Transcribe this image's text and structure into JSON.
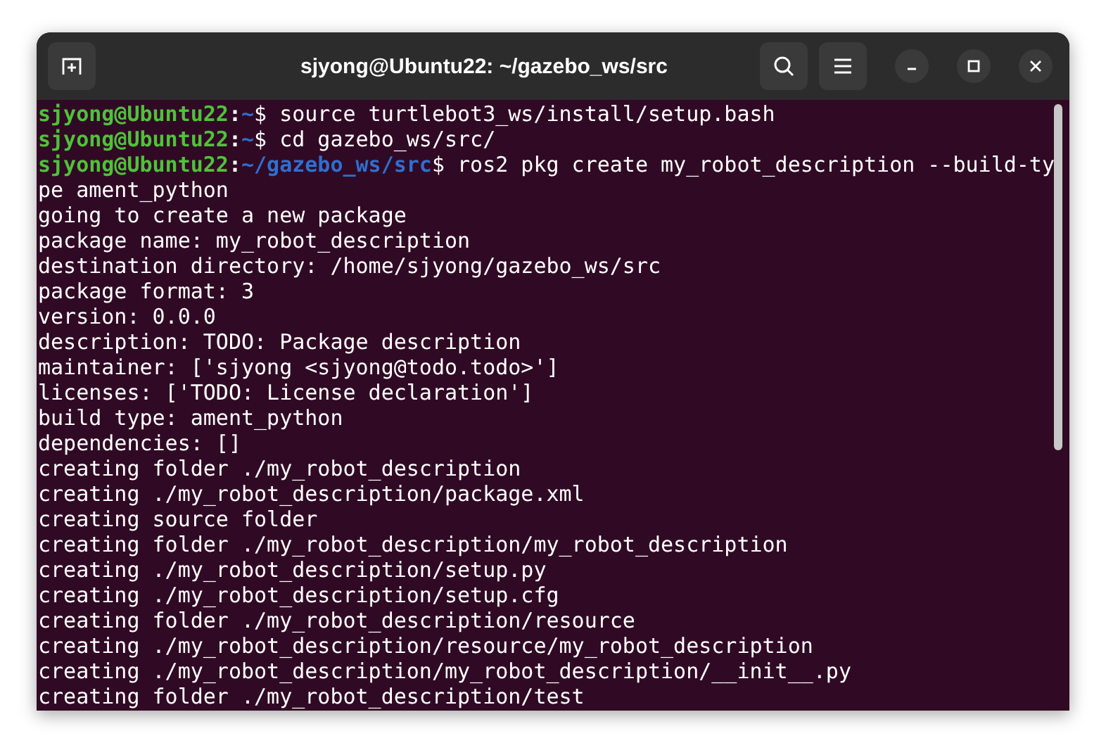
{
  "window": {
    "title": "sjyong@Ubuntu22: ~/gazebo_ws/src"
  },
  "terminal": {
    "lines": [
      {
        "kind": "prompt",
        "user": "sjyong@Ubuntu22",
        "sep": ":",
        "path": "~",
        "symbol": "$",
        "command": " source turtlebot3_ws/install/setup.bash"
      },
      {
        "kind": "prompt",
        "user": "sjyong@Ubuntu22",
        "sep": ":",
        "path": "~",
        "symbol": "$",
        "command": " cd gazebo_ws/src/"
      },
      {
        "kind": "prompt",
        "user": "sjyong@Ubuntu22",
        "sep": ":",
        "path": "~/gazebo_ws/src",
        "symbol": "$",
        "command": " ros2 pkg create my_robot_description --build-ty"
      },
      {
        "kind": "output",
        "text": "pe ament_python"
      },
      {
        "kind": "output",
        "text": "going to create a new package"
      },
      {
        "kind": "output",
        "text": "package name: my_robot_description"
      },
      {
        "kind": "output",
        "text": "destination directory: /home/sjyong/gazebo_ws/src"
      },
      {
        "kind": "output",
        "text": "package format: 3"
      },
      {
        "kind": "output",
        "text": "version: 0.0.0"
      },
      {
        "kind": "output",
        "text": "description: TODO: Package description"
      },
      {
        "kind": "output",
        "text": "maintainer: ['sjyong <sjyong@todo.todo>']"
      },
      {
        "kind": "output",
        "text": "licenses: ['TODO: License declaration']"
      },
      {
        "kind": "output",
        "text": "build type: ament_python"
      },
      {
        "kind": "output",
        "text": "dependencies: []"
      },
      {
        "kind": "output",
        "text": "creating folder ./my_robot_description"
      },
      {
        "kind": "output",
        "text": "creating ./my_robot_description/package.xml"
      },
      {
        "kind": "output",
        "text": "creating source folder"
      },
      {
        "kind": "output",
        "text": "creating folder ./my_robot_description/my_robot_description"
      },
      {
        "kind": "output",
        "text": "creating ./my_robot_description/setup.py"
      },
      {
        "kind": "output",
        "text": "creating ./my_robot_description/setup.cfg"
      },
      {
        "kind": "output",
        "text": "creating folder ./my_robot_description/resource"
      },
      {
        "kind": "output",
        "text": "creating ./my_robot_description/resource/my_robot_description"
      },
      {
        "kind": "output",
        "text": "creating ./my_robot_description/my_robot_description/__init__.py"
      },
      {
        "kind": "output",
        "text": "creating folder ./my_robot_description/test"
      }
    ]
  }
}
